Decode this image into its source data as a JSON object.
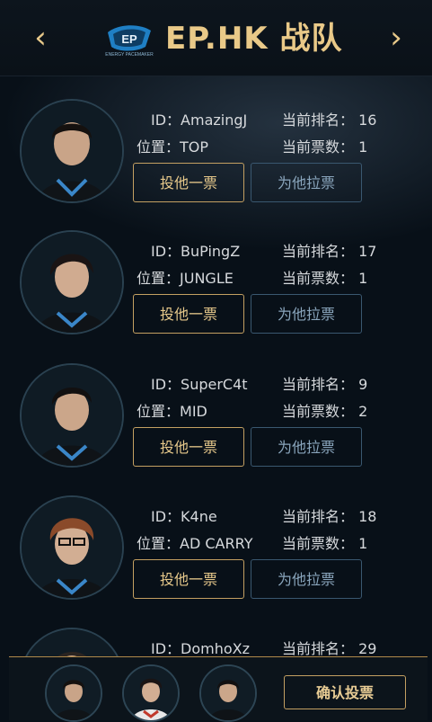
{
  "header": {
    "title": "EP.HK 战队",
    "prev_icon": "chevron-left-icon",
    "next_icon": "chevron-right-icon",
    "logo_text": "ENERGY PACEMAKER"
  },
  "labels": {
    "id": "ID：",
    "position": "位置：",
    "rank": "当前排名：",
    "votes": "当前票数："
  },
  "players": [
    {
      "id": "AmazingJ",
      "position": "TOP",
      "rank": "16",
      "votes": "1",
      "vote_label": "投他一票",
      "canvass_label": "为他拉票"
    },
    {
      "id": "BuPingZ",
      "position": "JUNGLE",
      "rank": "17",
      "votes": "1",
      "vote_label": "投他一票",
      "canvass_label": "为他拉票"
    },
    {
      "id": "SuperC4t",
      "position": "MID",
      "rank": "9",
      "votes": "2",
      "vote_label": "投他一票",
      "canvass_label": "为他拉票"
    },
    {
      "id": "K4ne",
      "position": "AD CARRY",
      "rank": "18",
      "votes": "1",
      "vote_label": "投他一票",
      "canvass_label": "为他拉票"
    },
    {
      "id": "DomhoXz",
      "position": "",
      "rank": "29",
      "votes": "",
      "vote_label": "",
      "canvass_label": ""
    }
  ],
  "footer": {
    "confirm_label": "确认投票"
  },
  "colors": {
    "accent": "#e9c988",
    "background": "#081018",
    "secondary_border": "#3a5870"
  }
}
